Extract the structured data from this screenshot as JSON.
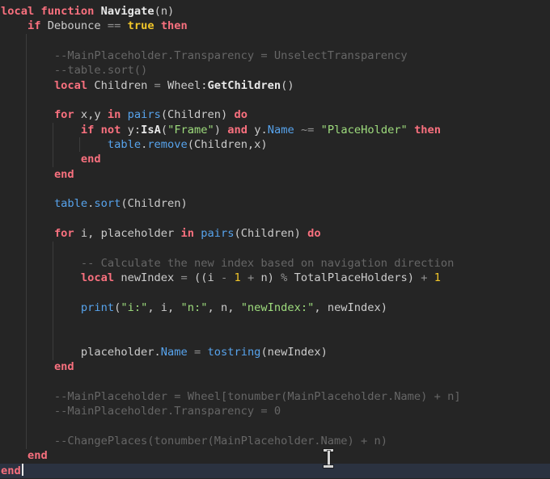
{
  "editor": {
    "language": "lua",
    "theme": {
      "background": "#252525",
      "current_line_background": "#2b3240",
      "keyword_color": "#f8707e",
      "text_color": "#cccccc",
      "operator_color": "#919191",
      "builtin_color": "#57a3ec",
      "method_color": "#e8e8e8",
      "string_color": "#9edc7d",
      "number_color": "#f0c529",
      "comment_color": "#666666",
      "indent_guide_color": "#3c3c3c"
    },
    "cursor_line_index": 31,
    "lines": [
      [
        [
          "k",
          "local"
        ],
        [
          "v",
          " "
        ],
        [
          "k",
          "function"
        ],
        [
          "v",
          " "
        ],
        [
          "m",
          "Navigate"
        ],
        [
          "v",
          "(n)"
        ]
      ],
      [
        [
          "v",
          "    "
        ],
        [
          "k",
          "if"
        ],
        [
          "v",
          " Debounce "
        ],
        [
          "o",
          "=="
        ],
        [
          "v",
          " "
        ],
        [
          "t",
          "true"
        ],
        [
          "v",
          " "
        ],
        [
          "k",
          "then"
        ]
      ],
      [],
      [
        [
          "c",
          "        --MainPlaceholder.Transparency = UnselectTransparency"
        ]
      ],
      [
        [
          "c",
          "        --table.sort()"
        ]
      ],
      [
        [
          "v",
          "        "
        ],
        [
          "k",
          "local"
        ],
        [
          "v",
          " Children "
        ],
        [
          "o",
          "="
        ],
        [
          "v",
          " Wheel:"
        ],
        [
          "m",
          "GetChildren"
        ],
        [
          "v",
          "()"
        ]
      ],
      [],
      [
        [
          "v",
          "        "
        ],
        [
          "k",
          "for"
        ],
        [
          "v",
          " x,y "
        ],
        [
          "k",
          "in"
        ],
        [
          "v",
          " "
        ],
        [
          "b",
          "pairs"
        ],
        [
          "v",
          "(Children) "
        ],
        [
          "k",
          "do"
        ]
      ],
      [
        [
          "v",
          "            "
        ],
        [
          "k",
          "if"
        ],
        [
          "v",
          " "
        ],
        [
          "k",
          "not"
        ],
        [
          "v",
          " y:"
        ],
        [
          "m",
          "IsA"
        ],
        [
          "v",
          "("
        ],
        [
          "s",
          "\"Frame\""
        ],
        [
          "v",
          ") "
        ],
        [
          "k",
          "and"
        ],
        [
          "v",
          " y."
        ],
        [
          "b",
          "Name"
        ],
        [
          "v",
          " "
        ],
        [
          "o",
          "~="
        ],
        [
          "v",
          " "
        ],
        [
          "s",
          "\"PlaceHolder\""
        ],
        [
          "v",
          " "
        ],
        [
          "k",
          "then"
        ]
      ],
      [
        [
          "v",
          "                "
        ],
        [
          "b",
          "table"
        ],
        [
          "v",
          "."
        ],
        [
          "b",
          "remove"
        ],
        [
          "v",
          "(Children,x)"
        ]
      ],
      [
        [
          "v",
          "            "
        ],
        [
          "k",
          "end"
        ]
      ],
      [
        [
          "v",
          "        "
        ],
        [
          "k",
          "end"
        ]
      ],
      [],
      [
        [
          "v",
          "        "
        ],
        [
          "b",
          "table"
        ],
        [
          "v",
          "."
        ],
        [
          "b",
          "sort"
        ],
        [
          "v",
          "(Children)"
        ]
      ],
      [],
      [
        [
          "v",
          "        "
        ],
        [
          "k",
          "for"
        ],
        [
          "v",
          " i, placeholder "
        ],
        [
          "k",
          "in"
        ],
        [
          "v",
          " "
        ],
        [
          "b",
          "pairs"
        ],
        [
          "v",
          "(Children) "
        ],
        [
          "k",
          "do"
        ]
      ],
      [],
      [
        [
          "c",
          "            -- Calculate the new index based on navigation direction"
        ]
      ],
      [
        [
          "v",
          "            "
        ],
        [
          "k",
          "local"
        ],
        [
          "v",
          " newIndex "
        ],
        [
          "o",
          "="
        ],
        [
          "v",
          " ((i "
        ],
        [
          "o",
          "-"
        ],
        [
          "v",
          " "
        ],
        [
          "n",
          "1"
        ],
        [
          "v",
          " "
        ],
        [
          "o",
          "+"
        ],
        [
          "v",
          " n) "
        ],
        [
          "o",
          "%"
        ],
        [
          "v",
          " TotalPlaceHolders) "
        ],
        [
          "o",
          "+"
        ],
        [
          "v",
          " "
        ],
        [
          "n",
          "1"
        ]
      ],
      [],
      [
        [
          "v",
          "            "
        ],
        [
          "b",
          "print"
        ],
        [
          "v",
          "("
        ],
        [
          "s",
          "\"i:\""
        ],
        [
          "v",
          ", i, "
        ],
        [
          "s",
          "\"n:\""
        ],
        [
          "v",
          ", n, "
        ],
        [
          "s",
          "\"newIndex:\""
        ],
        [
          "v",
          ", newIndex)"
        ]
      ],
      [],
      [],
      [
        [
          "v",
          "            placeholder."
        ],
        [
          "b",
          "Name"
        ],
        [
          "v",
          " "
        ],
        [
          "o",
          "="
        ],
        [
          "v",
          " "
        ],
        [
          "b",
          "tostring"
        ],
        [
          "v",
          "(newIndex)"
        ]
      ],
      [
        [
          "v",
          "        "
        ],
        [
          "k",
          "end"
        ]
      ],
      [],
      [
        [
          "c",
          "        --MainPlaceholder = Wheel[tonumber(MainPlaceholder.Name) + n]"
        ]
      ],
      [
        [
          "c",
          "        --MainPlaceholder.Transparency = 0"
        ]
      ],
      [],
      [
        [
          "c",
          "        --ChangePlaces(tonumber(MainPlaceholder.Name) + n)"
        ]
      ],
      [
        [
          "v",
          "    "
        ],
        [
          "k",
          "end"
        ]
      ],
      [
        [
          "k",
          "end"
        ]
      ]
    ]
  },
  "cursor": {
    "text_caret_after": "end",
    "mouse_cursor": "i-beam"
  }
}
